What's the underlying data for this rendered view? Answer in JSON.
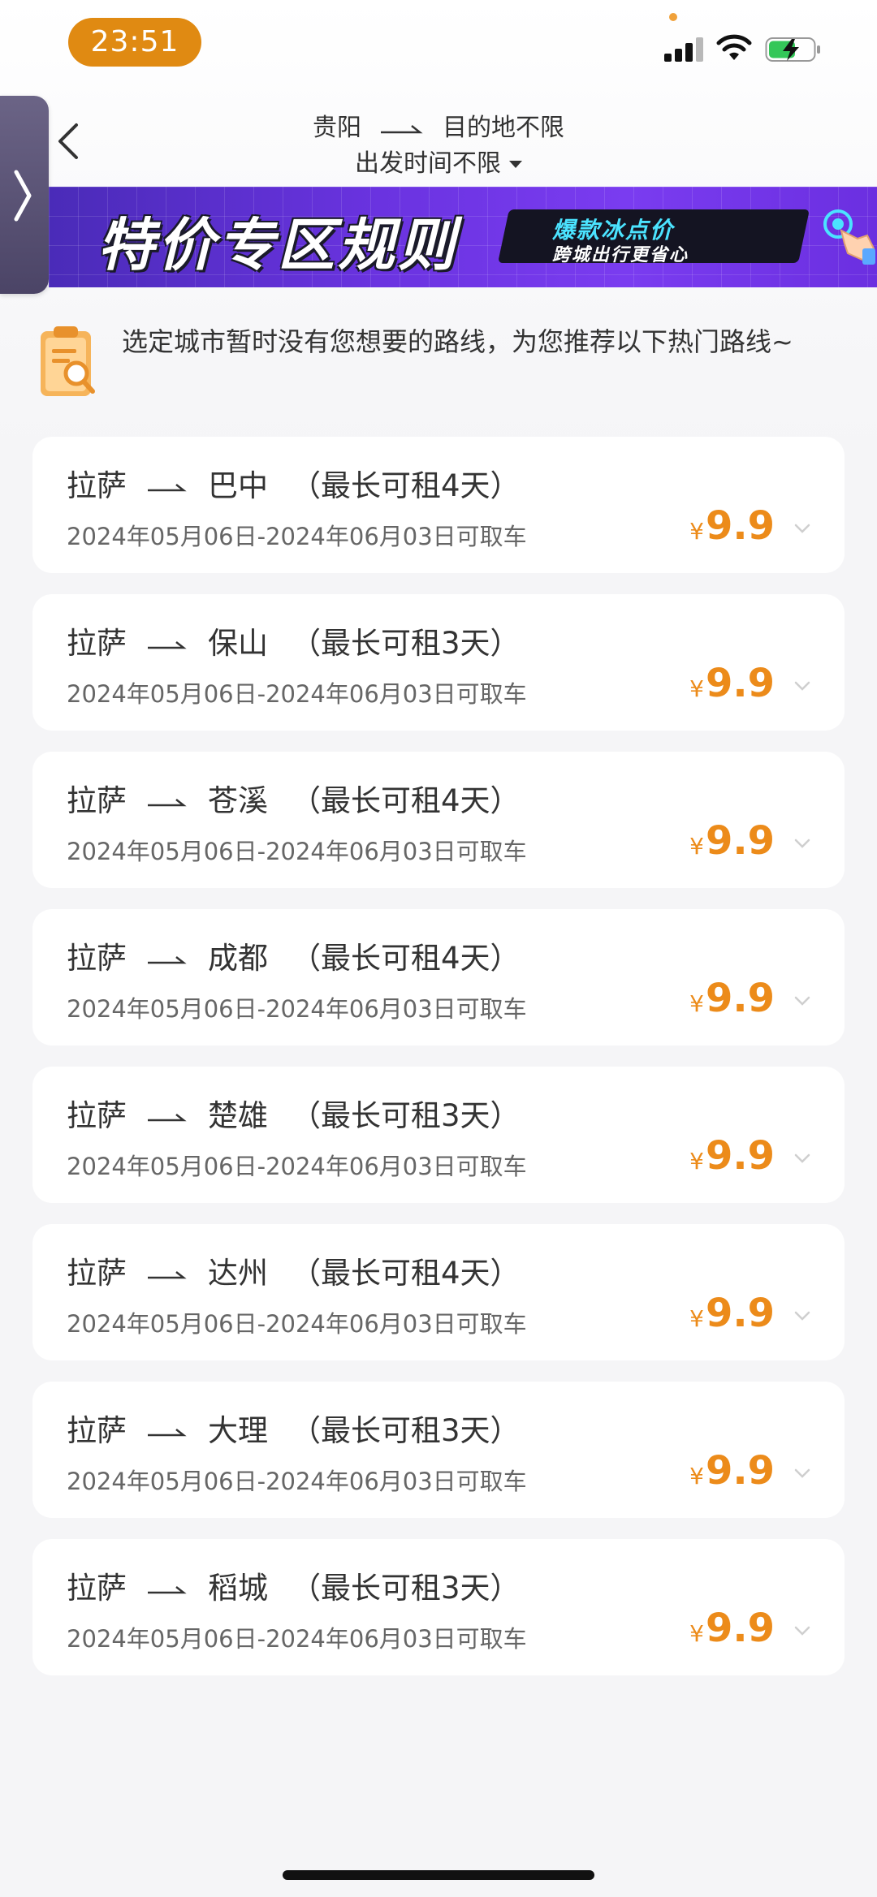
{
  "status_bar": {
    "time": "23:51"
  },
  "header": {
    "origin": "贵阳",
    "destination": "目的地不限",
    "time_filter": "出发时间不限"
  },
  "banner": {
    "title": "特价专区规则",
    "subtitle_1": "爆款冰点价",
    "subtitle_2": "跨城出行更省心"
  },
  "notice": {
    "text": "选定城市暂时没有您想要的路线，为您推荐以下热门路线~"
  },
  "routes": [
    {
      "from": "拉萨",
      "to": "巴中",
      "rent": "（最长可租4天）",
      "dates": "2024年05月06日-2024年06月03日可取车",
      "currency": "¥",
      "price": "9.9"
    },
    {
      "from": "拉萨",
      "to": "保山",
      "rent": "（最长可租3天）",
      "dates": "2024年05月06日-2024年06月03日可取车",
      "currency": "¥",
      "price": "9.9"
    },
    {
      "from": "拉萨",
      "to": "苍溪",
      "rent": "（最长可租4天）",
      "dates": "2024年05月06日-2024年06月03日可取车",
      "currency": "¥",
      "price": "9.9"
    },
    {
      "from": "拉萨",
      "to": "成都",
      "rent": "（最长可租4天）",
      "dates": "2024年05月06日-2024年06月03日可取车",
      "currency": "¥",
      "price": "9.9"
    },
    {
      "from": "拉萨",
      "to": "楚雄",
      "rent": "（最长可租3天）",
      "dates": "2024年05月06日-2024年06月03日可取车",
      "currency": "¥",
      "price": "9.9"
    },
    {
      "from": "拉萨",
      "to": "达州",
      "rent": "（最长可租4天）",
      "dates": "2024年05月06日-2024年06月03日可取车",
      "currency": "¥",
      "price": "9.9"
    },
    {
      "from": "拉萨",
      "to": "大理",
      "rent": "（最长可租3天）",
      "dates": "2024年05月06日-2024年06月03日可取车",
      "currency": "¥",
      "price": "9.9"
    },
    {
      "from": "拉萨",
      "to": "稻城",
      "rent": "（最长可租3天）",
      "dates": "2024年05月06日-2024年06月03日可取车",
      "currency": "¥",
      "price": "9.9"
    }
  ],
  "colors": {
    "accent": "#ec8b1a",
    "time_pill": "#e08a12",
    "banner": "#6a33e0"
  },
  "icons": {
    "back": "chevron-left-icon",
    "side_tab": "chevron-right-icon",
    "notice": "clipboard-search-icon",
    "expand": "chevron-down-icon"
  }
}
